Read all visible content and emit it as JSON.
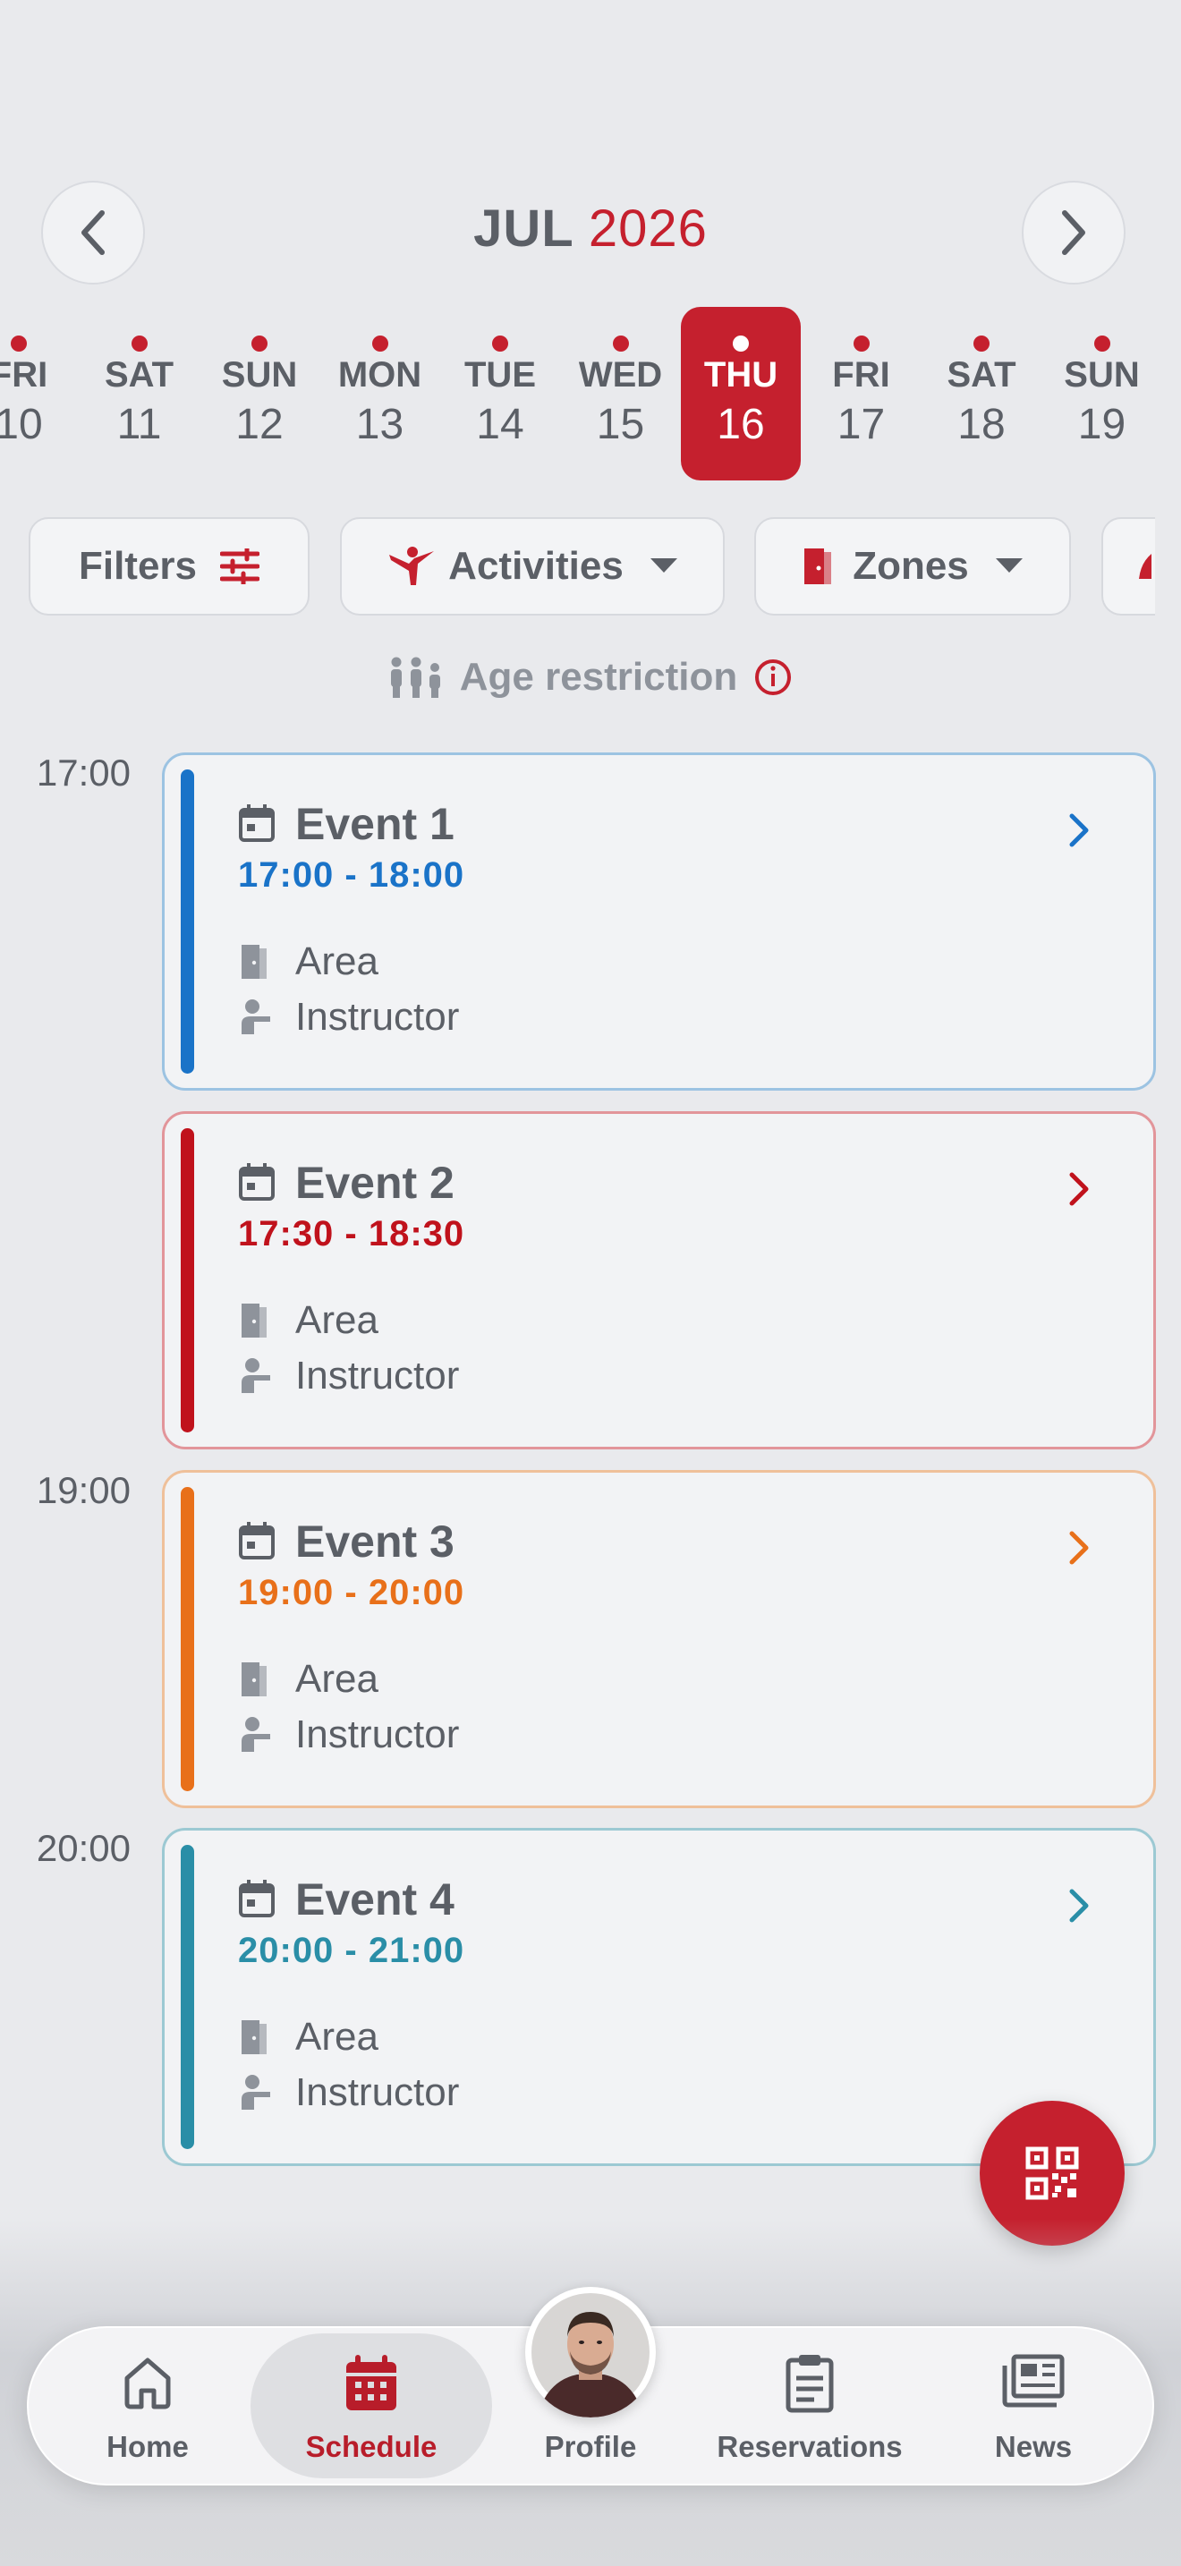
{
  "header": {
    "month": "JUL",
    "year": "2026",
    "prev_icon": "chevron-left-icon",
    "next_icon": "chevron-right-icon"
  },
  "days": [
    {
      "dow": "FRI",
      "num": "10",
      "has_event": true,
      "selected": false
    },
    {
      "dow": "SAT",
      "num": "11",
      "has_event": true,
      "selected": false
    },
    {
      "dow": "SUN",
      "num": "12",
      "has_event": true,
      "selected": false
    },
    {
      "dow": "MON",
      "num": "13",
      "has_event": true,
      "selected": false
    },
    {
      "dow": "TUE",
      "num": "14",
      "has_event": true,
      "selected": false
    },
    {
      "dow": "WED",
      "num": "15",
      "has_event": true,
      "selected": false
    },
    {
      "dow": "THU",
      "num": "16",
      "has_event": true,
      "selected": true
    },
    {
      "dow": "FRI",
      "num": "17",
      "has_event": true,
      "selected": false
    },
    {
      "dow": "SAT",
      "num": "18",
      "has_event": true,
      "selected": false
    },
    {
      "dow": "SUN",
      "num": "19",
      "has_event": true,
      "selected": false
    }
  ],
  "filters": {
    "filters_label": "Filters",
    "activities_label": "Activities",
    "zones_label": "Zones"
  },
  "age_restriction": "Age restriction",
  "time_labels": [
    "17:00",
    "19:00",
    "20:00"
  ],
  "events": [
    {
      "title": "Event 1",
      "time": "17:00 - 18:00",
      "area": "Area",
      "instructor": "Instructor",
      "accent": "#1a73c8",
      "border": "#9cc3e2"
    },
    {
      "title": "Event 2",
      "time": "17:30 - 18:30",
      "area": "Area",
      "instructor": "Instructor",
      "accent": "#c0121c",
      "border": "#e2959a"
    },
    {
      "title": "Event 3",
      "time": "19:00 - 20:00",
      "area": "Area",
      "instructor": "Instructor",
      "accent": "#e8701a",
      "border": "#efc09a"
    },
    {
      "title": "Event 4",
      "time": "20:00 - 21:00",
      "area": "Area",
      "instructor": "Instructor",
      "accent": "#2a8ea7",
      "border": "#9cc9d3"
    }
  ],
  "fab_icon": "qr-code-icon",
  "nav": {
    "home": "Home",
    "schedule": "Schedule",
    "profile": "Profile",
    "reservations": "Reservations",
    "news": "News"
  },
  "colors": {
    "brand": "#c5202e",
    "background": "#e9eaed"
  }
}
